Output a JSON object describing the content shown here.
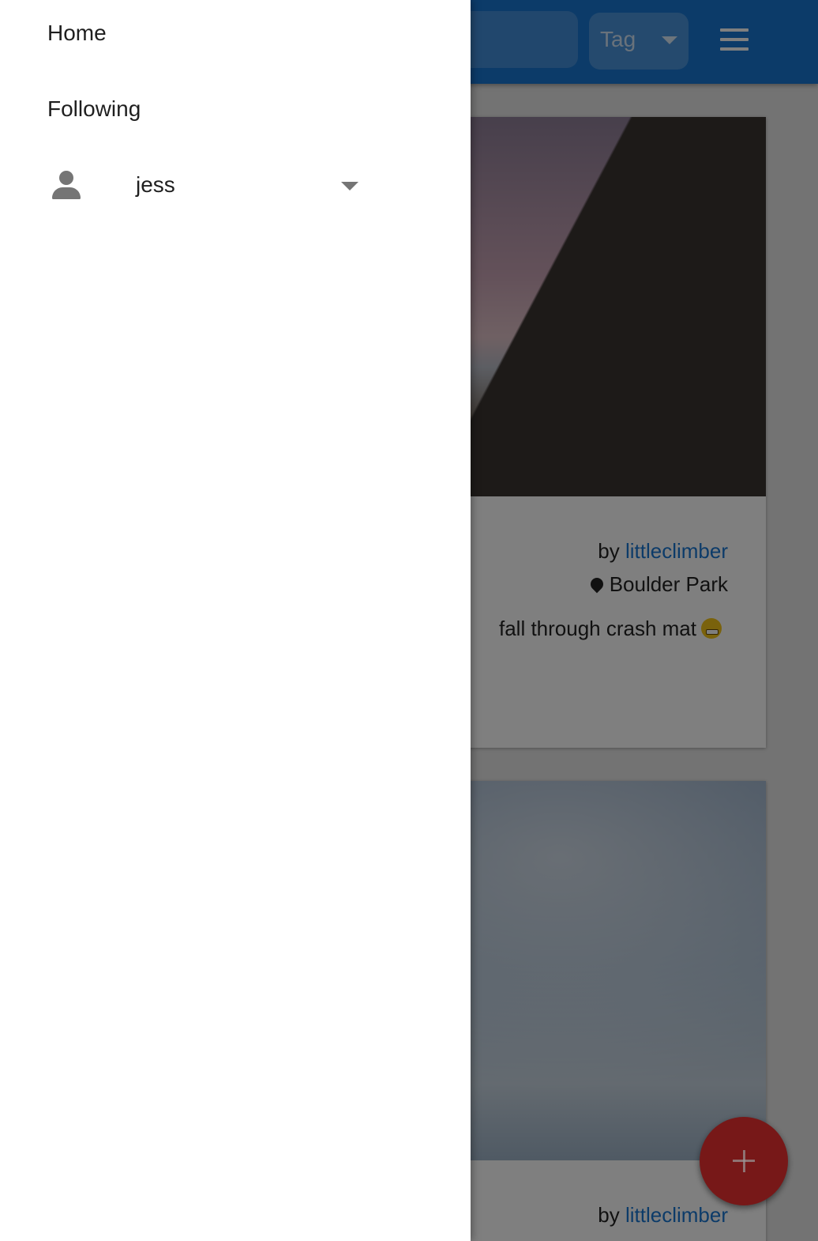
{
  "appbar": {
    "tag_label": "Tag",
    "color": "#1976d2"
  },
  "drawer": {
    "items": [
      {
        "label": "Home"
      },
      {
        "label": "Following"
      }
    ],
    "user": {
      "name": "jess",
      "icon": "person-icon"
    }
  },
  "feed": {
    "posts": [
      {
        "by_prefix": "by ",
        "author": "littleclimber",
        "location": "Boulder Park",
        "caption": "fall through crash mat"
      },
      {
        "by_prefix": "by ",
        "author": "littleclimber"
      }
    ]
  },
  "fab": {
    "icon": "plus-icon",
    "color": "#c62828"
  }
}
